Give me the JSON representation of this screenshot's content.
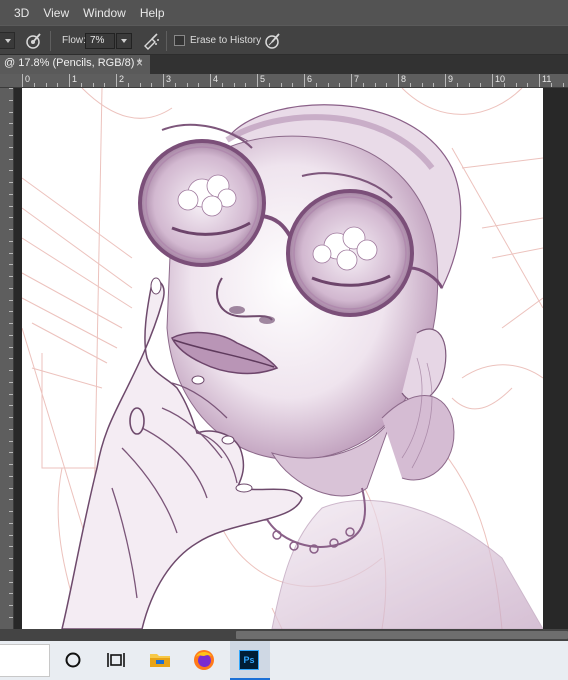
{
  "menubar": {
    "items": [
      "3D",
      "View",
      "Window",
      "Help"
    ]
  },
  "options": {
    "flow_label": "Flow:",
    "flow_value": "7%",
    "erase_to_history_label": "Erase to History",
    "erase_to_history_checked": false
  },
  "document_tab": {
    "title": "@ 17.8% (Pencils, RGB/8) *",
    "close_glyph": "×"
  },
  "ruler": {
    "top_labels": [
      "0",
      "1",
      "2",
      "3",
      "4",
      "5",
      "6",
      "7",
      "8",
      "9",
      "10",
      "11"
    ],
    "left_labels": []
  },
  "canvas": {
    "description_layer": "Pencils"
  },
  "taskbar": {
    "apps": [
      "cortana-icon",
      "task-view-icon",
      "file-explorer-icon",
      "firefox-icon",
      "photoshop-icon"
    ],
    "photoshop_label": "Ps"
  },
  "colors": {
    "ps_blue": "#31a8ff",
    "sketch_purple": "#7a4f78",
    "sketch_red": "#e2a8a2"
  }
}
